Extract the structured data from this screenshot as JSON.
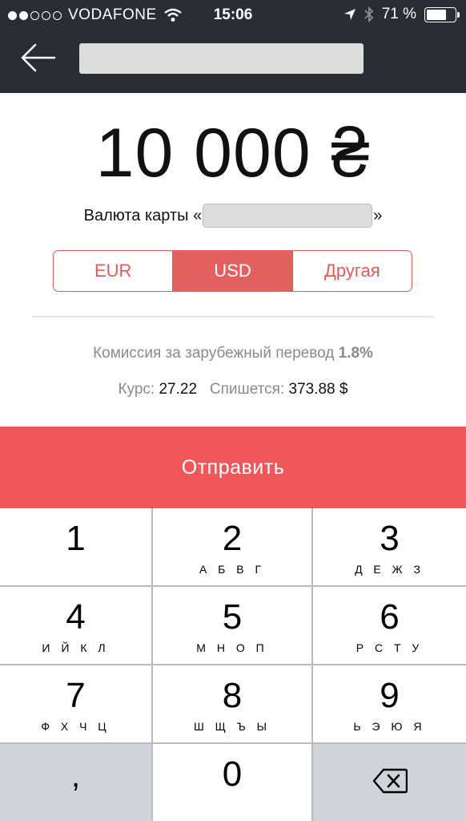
{
  "status_bar": {
    "carrier": "VODAFONE",
    "time": "15:06",
    "battery_percent": "71 %",
    "battery_level": 0.71
  },
  "nav": {
    "back_icon": "back-arrow-icon"
  },
  "transfer": {
    "amount": "10 000 ₴",
    "card_currency_prefix": "Валюта карты «",
    "card_currency_suffix": "»"
  },
  "currency_selector": {
    "options": [
      "EUR",
      "USD",
      "Другая"
    ],
    "selected": "USD"
  },
  "info": {
    "fee_label": "Комиссия за зарубежный перевод",
    "fee_value": "1.8%",
    "rate_label": "Курс:",
    "rate_value": "27.22",
    "debit_label": "Спишется:",
    "debit_value": "373.88 $"
  },
  "send_button": "Отправить",
  "keypad": {
    "keys": [
      {
        "num": "1",
        "letters": ""
      },
      {
        "num": "2",
        "letters": "А Б В Г"
      },
      {
        "num": "3",
        "letters": "Д Е Ж З"
      },
      {
        "num": "4",
        "letters": "И Й К Л"
      },
      {
        "num": "5",
        "letters": "М Н О П"
      },
      {
        "num": "6",
        "letters": "Р С Т У"
      },
      {
        "num": "7",
        "letters": "Ф Х Ч Ц"
      },
      {
        "num": "8",
        "letters": "Ш Щ Ъ Ы"
      },
      {
        "num": "9",
        "letters": "Ь Э Ю Я"
      }
    ],
    "comma": ",",
    "zero": "0",
    "delete_icon": "backspace-icon"
  },
  "colors": {
    "accent": "#f0565a",
    "segment": "#e05a5a",
    "dark_bar": "#2a2d33"
  }
}
